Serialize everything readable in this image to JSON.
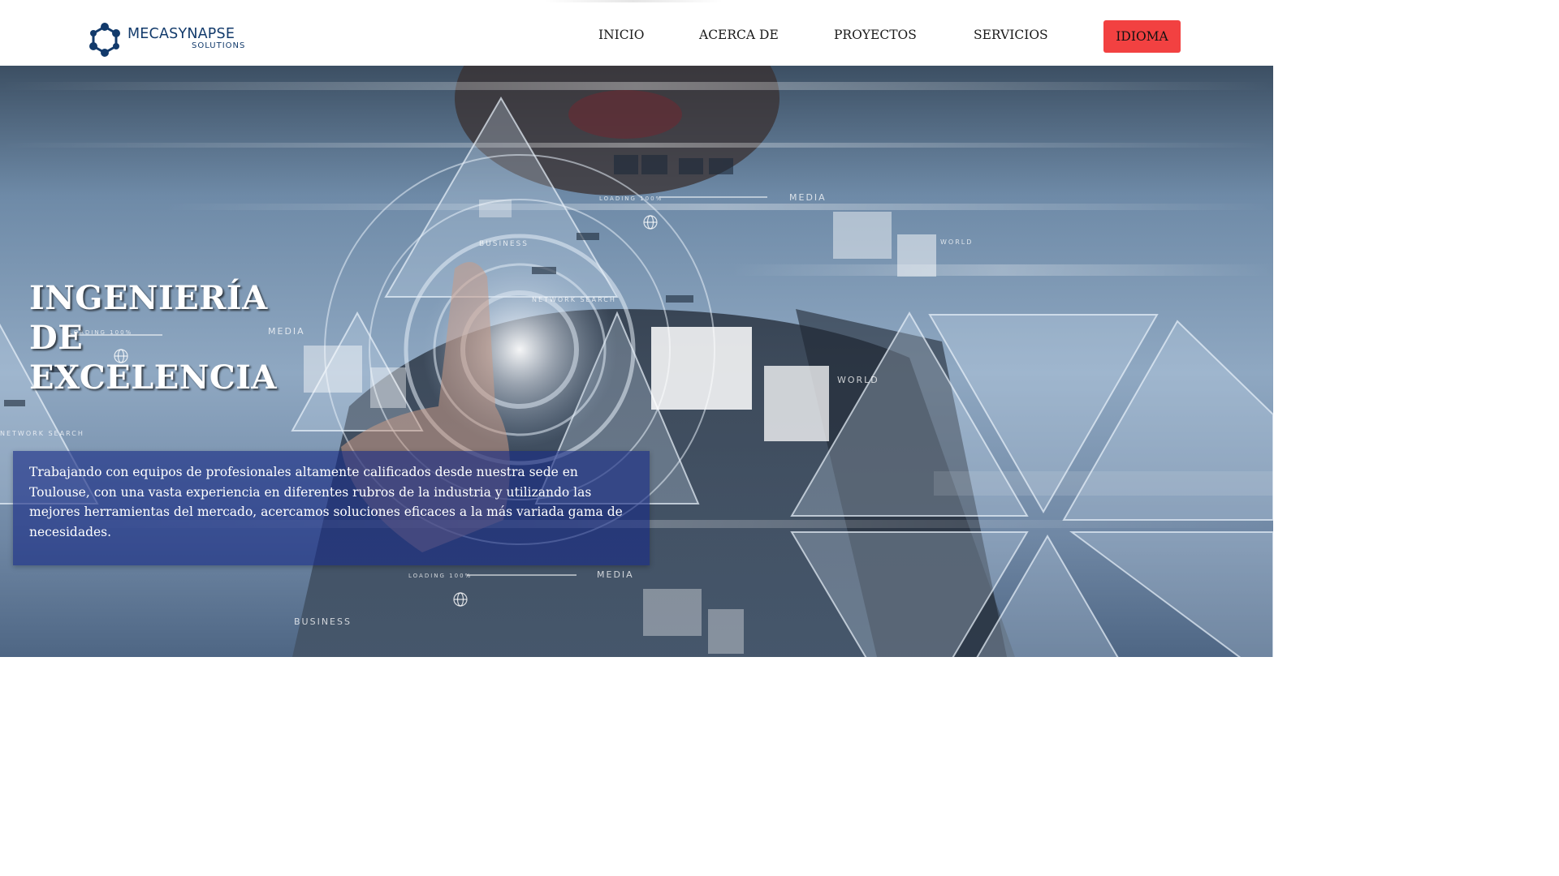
{
  "logo": {
    "name": "MECASYNAPSE",
    "subtitle": "SOLUTIONS"
  },
  "nav": {
    "items": [
      {
        "label": "INICIO"
      },
      {
        "label": "ACERCA DE"
      },
      {
        "label": "PROYECTOS"
      },
      {
        "label": "SERVICIOS"
      }
    ],
    "language_button": "IDIOMA"
  },
  "hero": {
    "title_lines": [
      "INGENIERÍA",
      "DE",
      "EXCELENCIA"
    ],
    "description": "Trabajando con equipos de profesionales altamente calificados desde nuestra sede en Toulouse, con una vasta experiencia en diferentes rubros de la industria y utilizando las mejores herramientas del mercado, acercamos soluciones eficaces a la más variada gama de necesidades.",
    "image_labels": [
      "WORLD",
      "MEDIA",
      "BUSINESS",
      "NETWORK SEARCH",
      "LOADING 100%"
    ]
  },
  "colors": {
    "brand_navy": "#123a6b",
    "accent_red": "#f24141",
    "hero_overlay": "#162a84"
  },
  "icons": [
    "logo-hexagon-network-icon"
  ]
}
